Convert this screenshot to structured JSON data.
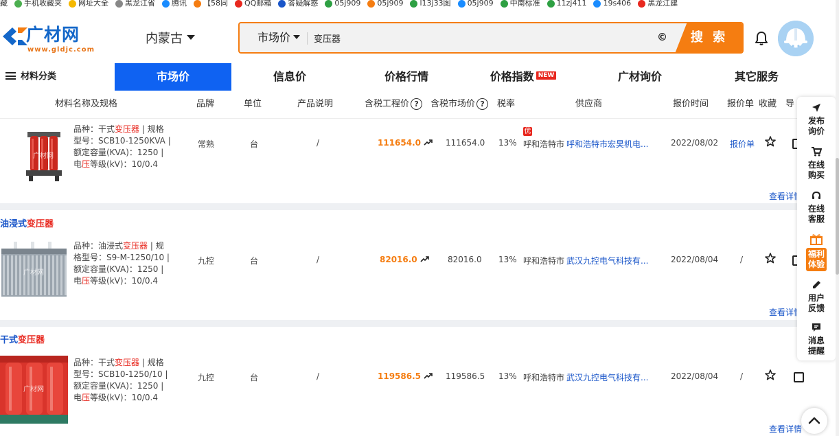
{
  "bookmarks": [
    {
      "label": "藏",
      "icon": "bookmark-icon",
      "color": "#999999"
    },
    {
      "label": "手机收藏夹",
      "icon": "phone-icon",
      "color": "#4caf50"
    },
    {
      "label": "网址大全",
      "icon": "site-nav-icon",
      "color": "#f5b800"
    },
    {
      "label": "黑龙江省",
      "icon": "globe-icon",
      "color": "#888888"
    },
    {
      "label": "腾讯",
      "icon": "tencent-icon",
      "color": "#1a8cff"
    },
    {
      "label": "【58同",
      "icon": "58-icon",
      "color": "#f57d11"
    },
    {
      "label": "QQ邮箱",
      "icon": "qq-mail-icon",
      "color": "#e8281f"
    },
    {
      "label": "答疑解惑",
      "icon": "pin-icon",
      "color": "#1a56c9"
    },
    {
      "label": "05j909",
      "icon": "green-icon",
      "color": "#2ea043"
    },
    {
      "label": "05j909",
      "icon": "stack-icon",
      "color": "#f57d11"
    },
    {
      "label": "l13j33图",
      "icon": "image-icon",
      "color": "#2ea043"
    },
    {
      "label": "05j909",
      "icon": "cloud-icon",
      "color": "#1a8cff"
    },
    {
      "label": "中南标准",
      "icon": "green-icon",
      "color": "#2ea043"
    },
    {
      "label": "11zj411",
      "icon": "green-icon",
      "color": "#2ea043"
    },
    {
      "label": "19s406",
      "icon": "clock-icon",
      "color": "#1a8cff"
    },
    {
      "label": "黑龙江建",
      "icon": "emblem-icon",
      "color": "#e8281f"
    }
  ],
  "header": {
    "logo_text": "广材网",
    "logo_url": "www.gldjc.com",
    "region": "内蒙古",
    "search_category": "市场价",
    "search_query": "变压器",
    "search_button": "搜 索"
  },
  "nav": {
    "category_label": "材料分类",
    "items": [
      {
        "label": "市场价",
        "active": true
      },
      {
        "label": "信息价"
      },
      {
        "label": "价格行情"
      },
      {
        "label": "价格指数",
        "badge": "NEW"
      },
      {
        "label": "广材询价"
      },
      {
        "label": "其它服务"
      }
    ]
  },
  "table": {
    "headers": {
      "name": "材料名称及规格",
      "brand": "品牌",
      "unit": "单位",
      "desc": "产品说明",
      "eng_price": "含税工程价",
      "market_price": "含税市场价",
      "tax": "税率",
      "supplier": "供应商",
      "date": "报价时间",
      "quote": "报价单",
      "fav": "收藏",
      "guide": "导"
    },
    "groups": [
      {
        "title_pre": "",
        "title_hl": "",
        "row": {
          "desc_lines": [
            {
              "pre": "品种：干式",
              "hl": "变压器",
              "post": " | 规格"
            },
            {
              "pre": "型号：SCB10-1250KVA |",
              "hl": "",
              "post": ""
            },
            {
              "pre": "额定容量(KVA)：1250 |",
              "hl": "",
              "post": ""
            },
            {
              "pre": "电",
              "hl": "压",
              "post": "等级(kV)：10/0.4"
            }
          ],
          "brand": "常熟",
          "unit": "台",
          "note": "/",
          "eng_price": "111654.0",
          "market_price": "111654.0",
          "tax": "13%",
          "badge": "优",
          "city": "呼和浩特市",
          "supplier": "呼和浩特市宏昊机电...",
          "date": "2022/08/02",
          "quote": "报价单"
        },
        "detail": "查看详情"
      },
      {
        "title_pre": "油浸式",
        "title_hl": "变压器",
        "row": {
          "desc_lines": [
            {
              "pre": "品种：油浸式",
              "hl": "变压器",
              "post": " | 规"
            },
            {
              "pre": "格型号：S9-M-1250/10 |",
              "hl": "",
              "post": ""
            },
            {
              "pre": "额定容量(KVA)：1250 |",
              "hl": "",
              "post": ""
            },
            {
              "pre": "电",
              "hl": "压",
              "post": "等级(kV)：10/0.4"
            }
          ],
          "brand": "九控",
          "unit": "台",
          "note": "/",
          "eng_price": "82016.0",
          "market_price": "82016.0",
          "tax": "13%",
          "badge": "",
          "city": "呼和浩特市",
          "supplier": "武汉九控电气科技有...",
          "date": "2022/08/04",
          "quote": "/"
        },
        "detail": "查看详情"
      },
      {
        "title_pre": "干式",
        "title_hl": "变压器",
        "row": {
          "desc_lines": [
            {
              "pre": "品种：干式",
              "hl": "变压器",
              "post": " | 规格"
            },
            {
              "pre": "型号：SCB10-1250/10 |",
              "hl": "",
              "post": ""
            },
            {
              "pre": "额定容量(KVA)：1250 |",
              "hl": "",
              "post": ""
            },
            {
              "pre": "电",
              "hl": "压",
              "post": "等级(kV)：10/0.4"
            }
          ],
          "brand": "九控",
          "unit": "台",
          "note": "/",
          "eng_price": "119586.5",
          "market_price": "119586.5",
          "tax": "13%",
          "badge": "",
          "city": "呼和浩特市",
          "supplier": "武汉九控电气科技有...",
          "date": "2022/08/04",
          "quote": "/"
        },
        "detail": "查看详情"
      }
    ]
  },
  "sidebar": {
    "items": [
      {
        "label1": "发布",
        "label2": "询价",
        "icon": "send-icon"
      },
      {
        "label1": "在线",
        "label2": "购买",
        "icon": "cart-icon"
      },
      {
        "label1": "在线",
        "label2": "客服",
        "icon": "headset-icon"
      },
      {
        "label1": "福利",
        "label2": "体验",
        "icon": "gift-icon"
      },
      {
        "label1": "用户",
        "label2": "反馈",
        "icon": "pen-icon"
      },
      {
        "label1": "消息",
        "label2": "提醒",
        "icon": "message-icon"
      }
    ]
  },
  "colors": {
    "brand_blue": "#0f62f2",
    "accent_orange": "#f57d11",
    "highlight_red": "#e8281f",
    "link_blue": "#1a56c9"
  },
  "watermark": "广材网"
}
